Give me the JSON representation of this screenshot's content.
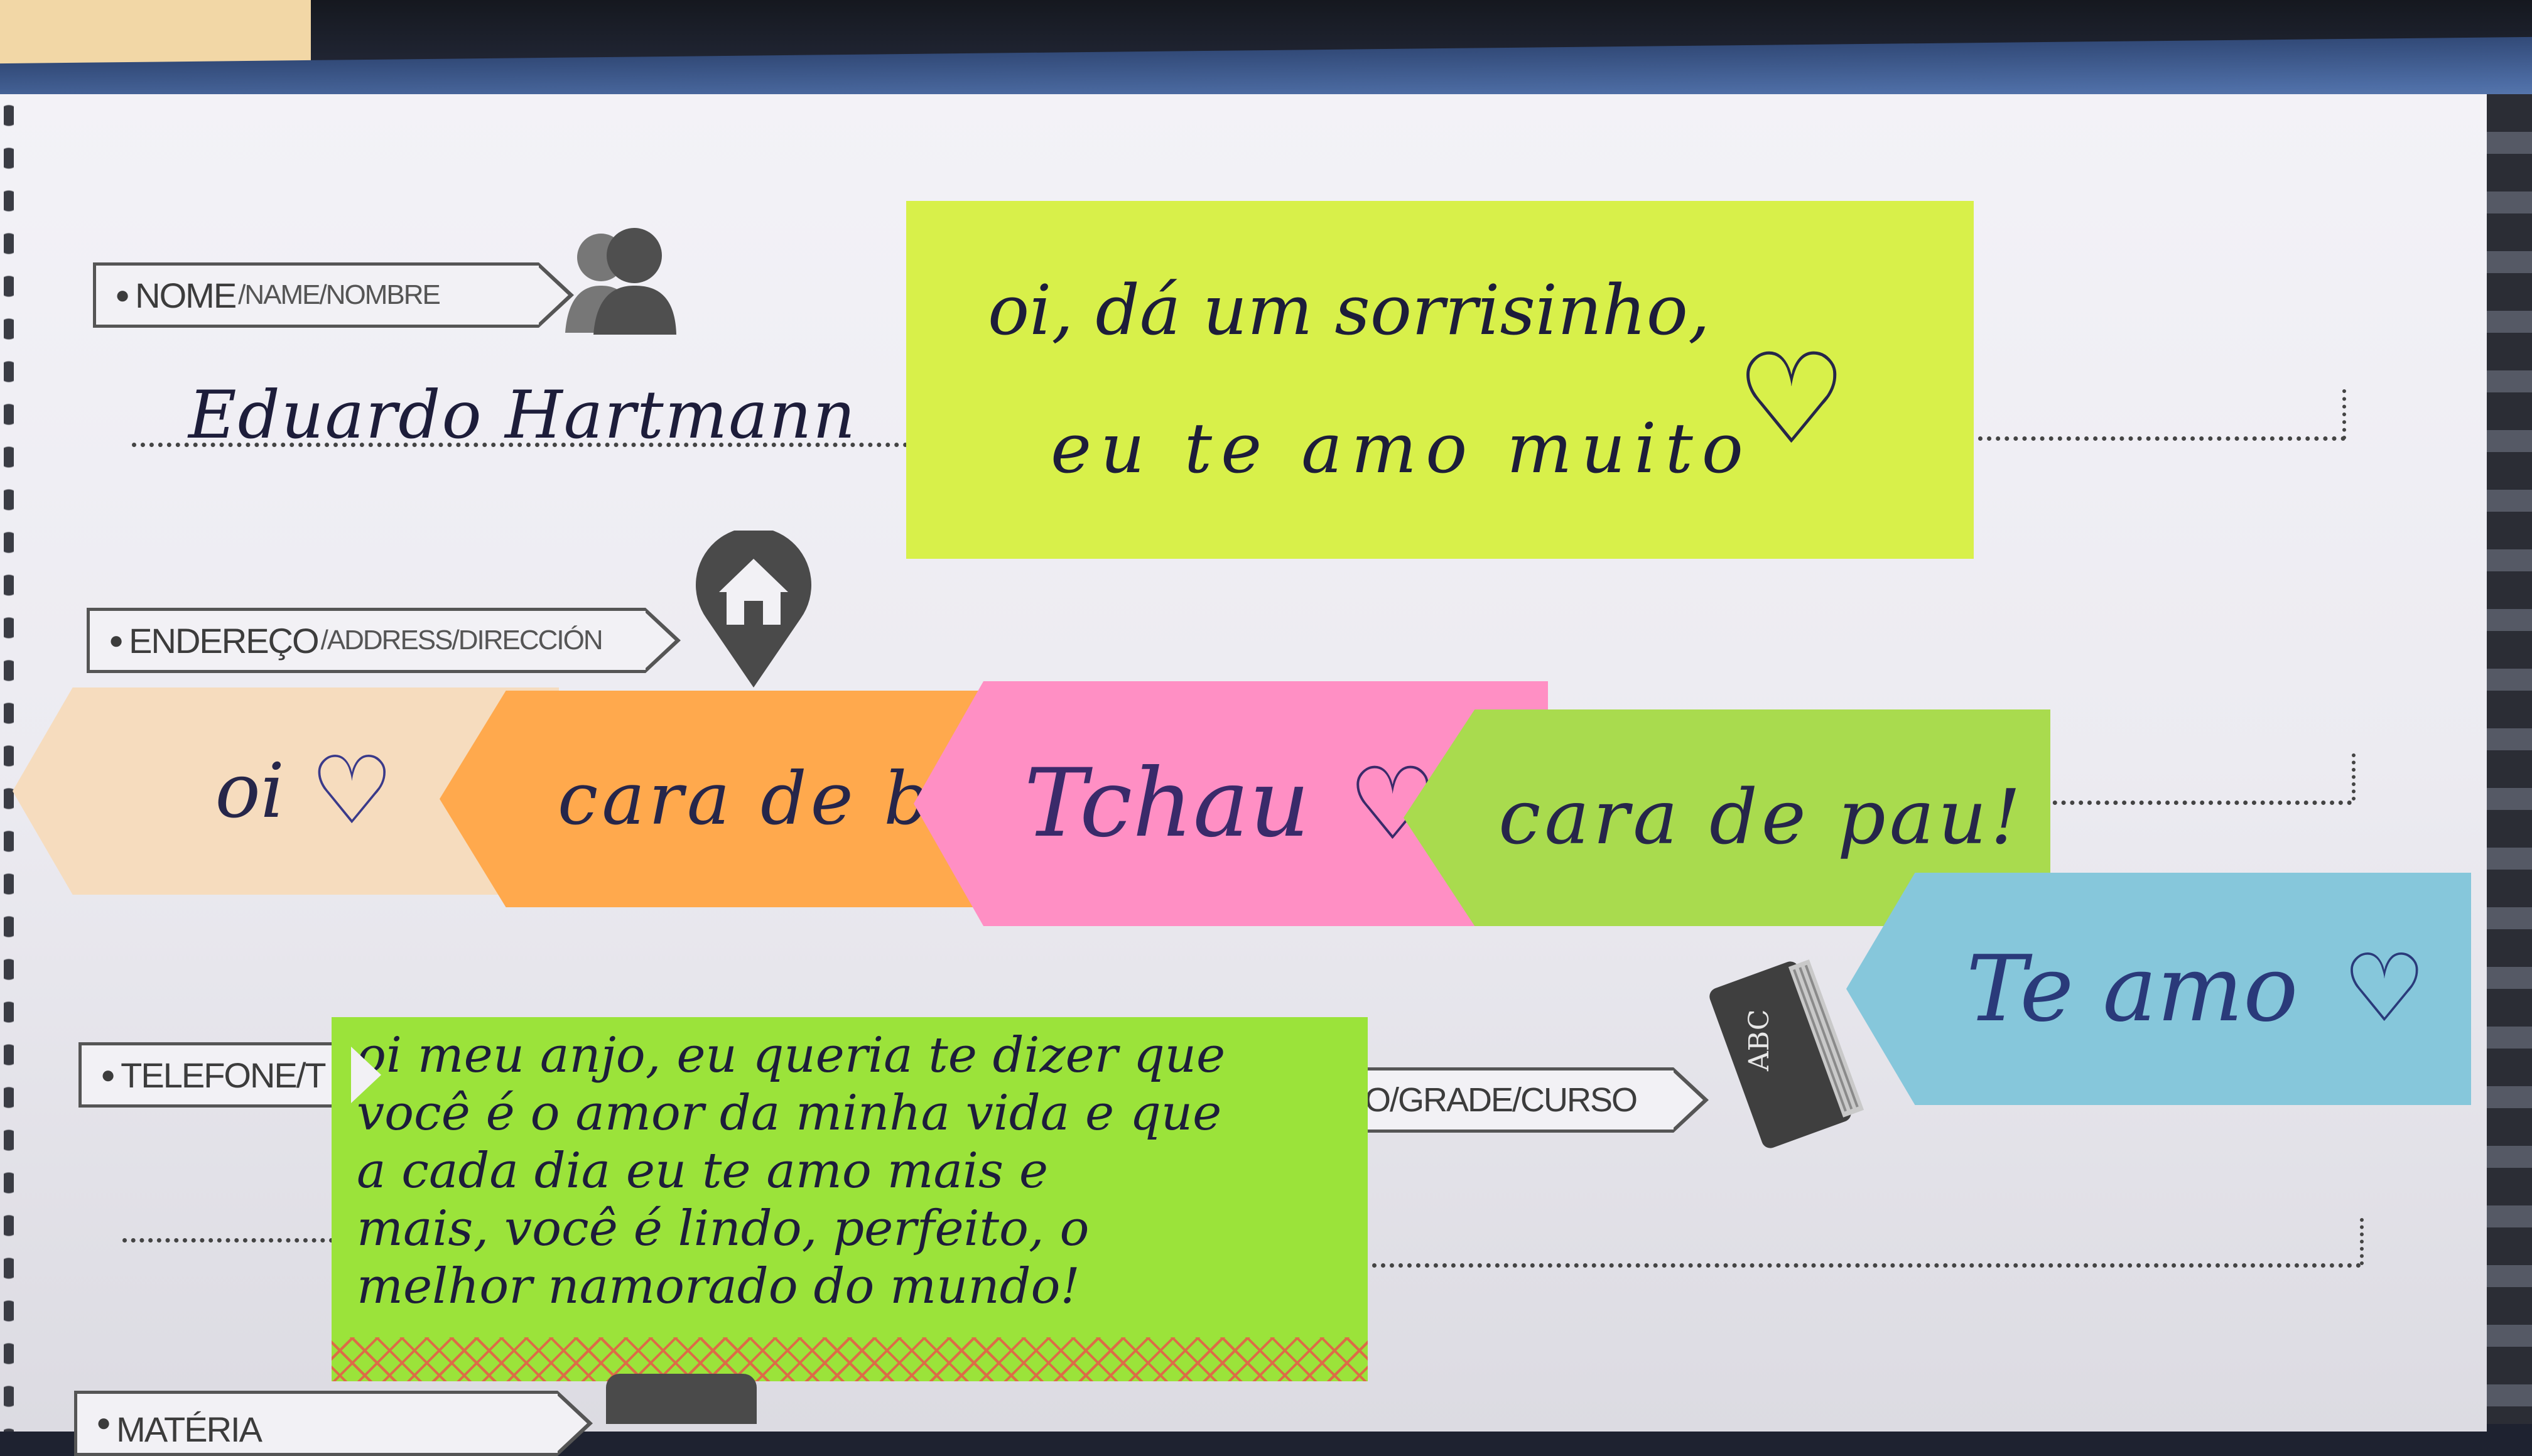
{
  "page_labels": {
    "name_label": {
      "main": "NOME",
      "sub": "/NAME/NOMBRE"
    },
    "address_label": {
      "main": "ENDEREÇO",
      "sub": "/ADDRESS/DIRECCIÓN"
    },
    "phone_label": {
      "main": "TELEFONE/T"
    },
    "grade_label": {
      "main": "O/GRADE/CURSO"
    },
    "subject_label": {
      "main": "MATÉRIA"
    },
    "book_icon_text": "ABC"
  },
  "handwritten_name": "Eduardo Hartmann",
  "notes": {
    "yellow_note": {
      "line1": "oi, dá um sorrisinho,",
      "line2": "eu te amo muito",
      "heart": "♡"
    },
    "arrow_flags": [
      {
        "text": "oi",
        "heart": "♡",
        "color": "#f6dcbe"
      },
      {
        "text": "cara de bo",
        "heart": "",
        "color": "#ffa94d"
      },
      {
        "text": "Tchau",
        "heart": "♡",
        "color": "#ff8fc4"
      },
      {
        "text": "cara de pau!",
        "heart": "",
        "color": "#a9db4e"
      },
      {
        "text": "Te amo",
        "heart": "♡",
        "color": "#86c7db"
      }
    ],
    "green_note": {
      "lines": [
        "oi meu anjo, eu queria te dizer que",
        "você é o amor da minha vida e que",
        "a cada dia eu te amo mais e",
        "mais, você é lindo, perfeito, o",
        "melhor namorado do mundo!"
      ]
    }
  },
  "colors": {
    "page": "#efeef4",
    "yellow_note": "#d8f04a",
    "green_note": "#9be33a",
    "label_border": "#555555"
  },
  "icons": [
    "people-icon",
    "house-pin-icon",
    "book-icon"
  ]
}
